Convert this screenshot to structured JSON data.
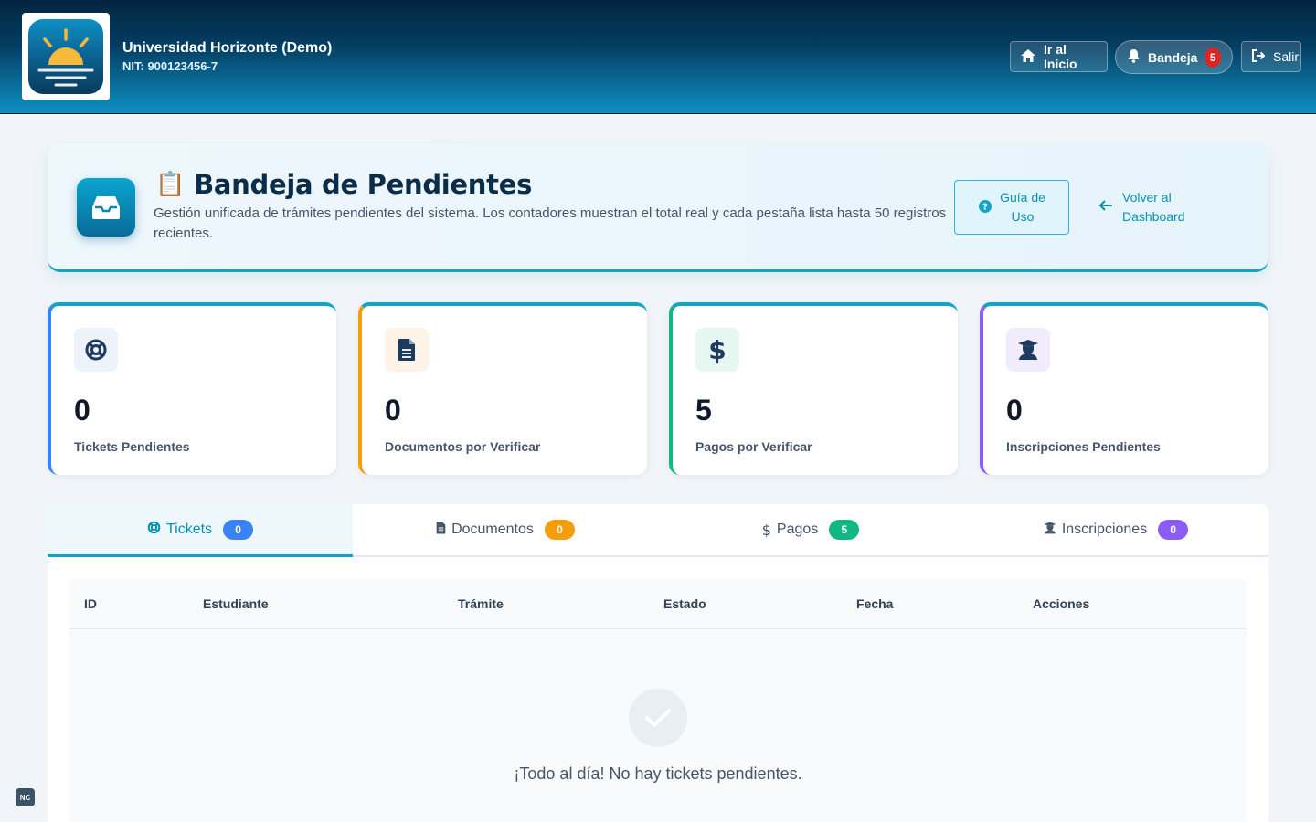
{
  "header": {
    "org_name": "Universidad Horizonte (Demo)",
    "org_nit": "NIT: 900123456-7",
    "home_label": "Ir al Inicio",
    "inbox_label": "Bandeja",
    "inbox_count": "5",
    "logout_label": "Salir"
  },
  "title_card": {
    "emoji": "📋",
    "title": "Bandeja de Pendientes",
    "description": "Gestión unificada de trámites pendientes del sistema. Los contadores muestran el total real y cada pestaña lista hasta 50 registros recientes.",
    "guide_label_1": "Guía de",
    "guide_label_2": "Uso",
    "back_label_1": "Volver al",
    "back_label_2": "Dashboard"
  },
  "stats": [
    {
      "value": "0",
      "label": "Tickets Pendientes",
      "icon": "lifebuoy-icon",
      "color": "#3b82f6"
    },
    {
      "value": "0",
      "label": "Documentos por Verificar",
      "icon": "file-icon",
      "color": "#f59e0b"
    },
    {
      "value": "5",
      "label": "Pagos por Verificar",
      "icon": "dollar-icon",
      "color": "#10b981"
    },
    {
      "value": "0",
      "label": "Inscripciones Pendientes",
      "icon": "graduate-icon",
      "color": "#8b5cf6"
    }
  ],
  "tabs": [
    {
      "label": "Tickets",
      "count": "0",
      "color": "#3b82f6"
    },
    {
      "label": "Documentos",
      "count": "0",
      "color": "#f59e0b"
    },
    {
      "label": "Pagos",
      "count": "5",
      "color": "#10b981"
    },
    {
      "label": "Inscripciones",
      "count": "0",
      "color": "#8b5cf6"
    }
  ],
  "table": {
    "columns": [
      "ID",
      "Estudiante",
      "Trámite",
      "Estado",
      "Fecha",
      "Acciones"
    ],
    "empty_message": "¡Todo al día! No hay tickets pendientes."
  },
  "footer_badge": "NC"
}
